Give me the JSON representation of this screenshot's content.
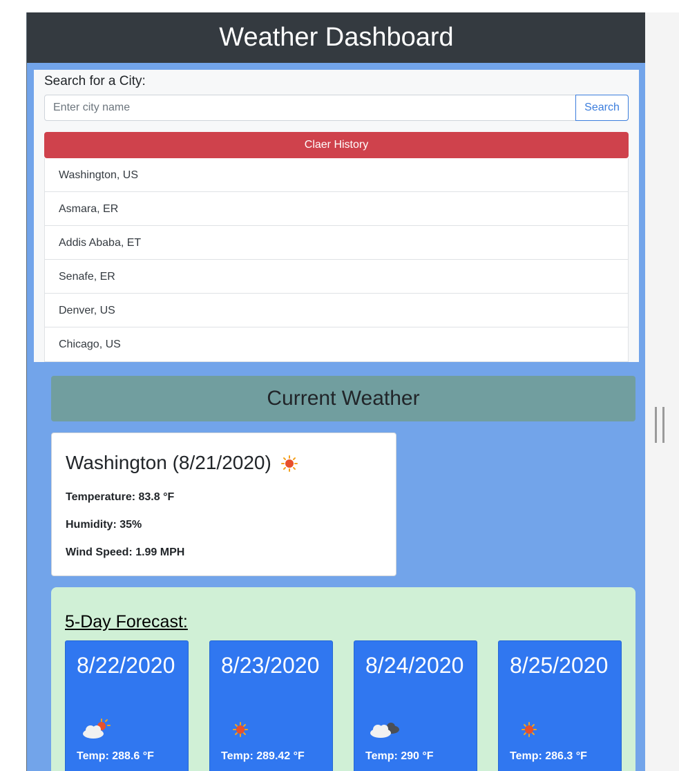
{
  "header": {
    "title": "Weather Dashboard"
  },
  "search": {
    "label": "Search for a City:",
    "placeholder": "Enter city name",
    "button_label": "Search",
    "clear_label": "Claer History"
  },
  "history": [
    "Washington, US",
    "Asmara, ER",
    "Addis Ababa, ET",
    "Senafe, ER",
    "Denver, US",
    "Chicago, US"
  ],
  "current": {
    "section_title": "Current Weather",
    "city": "Washington (8/21/2020)",
    "icon": "sun-icon",
    "temperature": "Temperature: 83.8 °F",
    "humidity": "Humidity: 35%",
    "wind": "Wind Speed: 1.99 MPH"
  },
  "forecast": {
    "title": "5-Day Forecast:",
    "days": [
      {
        "date": "8/22/2020",
        "icon": "partly-cloudy-icon",
        "temp": "Temp: 288.6 °F"
      },
      {
        "date": "8/23/2020",
        "icon": "sun-icon",
        "temp": "Temp: 289.42 °F"
      },
      {
        "date": "8/24/2020",
        "icon": "cloudy-icon",
        "temp": "Temp: 290 °F"
      },
      {
        "date": "8/25/2020",
        "icon": "sun-icon",
        "temp": "Temp: 286.3 °F"
      }
    ]
  },
  "colors": {
    "header_bg": "#343a40",
    "page_bg": "#72a4ea",
    "danger": "#cf424c",
    "primary": "#3077f0",
    "current_header_bg": "#719e9f",
    "forecast_bg": "#d0f0d6"
  }
}
